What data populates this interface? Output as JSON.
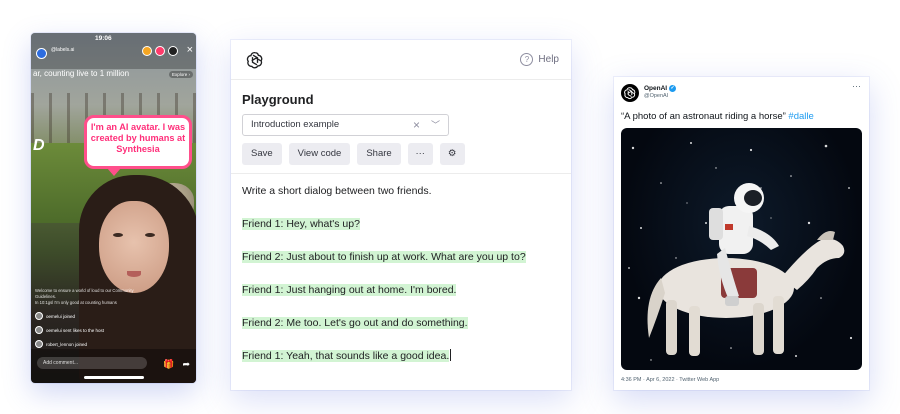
{
  "phone": {
    "time": "19:06",
    "account": "@labels.ai",
    "account_sub": "",
    "ticker": "ar, counting live to 1 million",
    "explore_label": "Explore ›",
    "speech_bubble": "I'm an AI avatar. I was created by humans at Synthesia",
    "brand_overlay": "D",
    "feed_lines": [
      "Welcome to ensure a world of loud to our Community Guidelines.",
      "In 10:1gsl I'm only good at counting humans"
    ],
    "feed_events": [
      "oemelui joined",
      "oemelui sent likes to the host",
      "robert_lennon joined"
    ],
    "comment_placeholder": "Add comment...",
    "bottom_icons": [
      "gift-icon",
      "share-icon"
    ]
  },
  "playground": {
    "help_label": "Help",
    "title": "Playground",
    "preset_value": "Introduction example",
    "buttons": {
      "save": "Save",
      "view_code": "View code",
      "share": "Share",
      "more": "···",
      "settings": "⚙"
    },
    "prompt": "Write a short dialog between two friends.",
    "completions": [
      "Friend 1: Hey, what's up?",
      "Friend 2: Just about to finish up at work. What are you up to?",
      "Friend 1: Just hanging out at home. I'm bored.",
      "Friend 2: Me too. Let's go out and do something.",
      "Friend 1: Yeah, that sounds like a good idea."
    ],
    "highlight_color": "#d2f4d3"
  },
  "tweet": {
    "name": "OpenAI",
    "verified_mark": "✓",
    "handle": "@OpenAI",
    "more_icon": "···",
    "text": "“A photo of an astronaut riding a horse” ",
    "hashtag": "#dalle",
    "meta": "4:36 PM · Apr 6, 2022 · Twitter Web App",
    "link_color": "#1d9bf0"
  }
}
